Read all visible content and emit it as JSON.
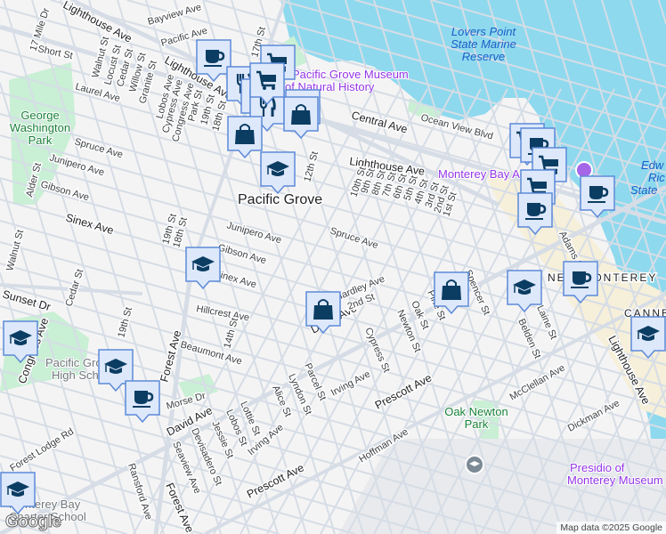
{
  "map": {
    "colors": {
      "land": "#f5f4f4",
      "water": "#8ed9ee",
      "park": "#c9efd5",
      "road": "#d6dde6",
      "marker_fill": "#dde8fb",
      "marker_border": "#5c8ad8",
      "marker_icon": "#0b3d63",
      "commercial": "#f6efd9",
      "military": "#e8eaed"
    },
    "labels": {
      "mile17": "17 Mile Dr",
      "lighthouse1": "Lighthouse Ave",
      "bayview": "Bayview Ave",
      "pacific": "Pacific Ave",
      "short": "Short St",
      "walnut": "Walnut St",
      "locust": "Locust St",
      "cedar": "Cedar St",
      "willow": "Willow St",
      "granite": "Granite St",
      "laurel": "Laurel Ave",
      "lighthouse2": "Lighthouse Ave",
      "lobos": "Lobos Ave",
      "cypressave": "Cypress Ave",
      "congress": "Congress Ave",
      "park": "Park St",
      "st19": "19th St",
      "st18": "18th St",
      "st17": "17th St",
      "spruce1": "Spruce Ave",
      "junipero1": "Junipero Ave",
      "gibson1": "Gibson Ave",
      "alder": "Alder St",
      "sinex1": "Sinex Ave",
      "walnut2": "Walnut St",
      "st19b": "19th St",
      "st18b": "18th St",
      "st12": "12th St",
      "junipero2": "Junipero Ave",
      "gibson2": "Gibson Ave",
      "sinex2": "Sinex Ave",
      "spruce2": "Spruce Ave",
      "central": "Central Ave",
      "oceanview": "Ocean View Blvd",
      "lighthouse3": "Lighthouse Ave",
      "st10": "10th St",
      "st9": "9th St",
      "st8": "8th St",
      "st7": "7th St",
      "st6": "6th St",
      "st5": "5th St",
      "st4": "4th St",
      "st3": "3rd St",
      "st2": "2nd St",
      "st1": "1st St",
      "hillcrest": "Hillcrest Ave",
      "beaumont": "Beaumont Ave",
      "morse": "Morse Dr",
      "sunset": "Sunset Dr",
      "cedar2": "Cedar St",
      "st19c": "19th St",
      "congress2": "Congress Ave",
      "forest1": "Forest Ave",
      "forest2": "Forest Ave",
      "st14": "14th St",
      "david1": "David Ave",
      "david2": "David Ave",
      "forestlodge": "Forest Lodge Rd",
      "seaview": "Seaview Ave",
      "ransford": "Ransford Ave",
      "devisadero": "Devisadero St",
      "jessie": "Jessie St",
      "lobosst": "Lobos St",
      "lottie": "Lottie St",
      "alice": "Alice St",
      "lyndon": "Lyndon St",
      "parcel": "Parcel St",
      "irving1": "Irving Ave",
      "prescott1": "Prescott Ave",
      "irving2": "Irving Ave",
      "prescott2": "Prescott Ave",
      "hoffman": "Hoffman Ave",
      "cypressst": "Cypress St",
      "newton": "Newton St",
      "oak": "Oak St",
      "pine": "Pine St",
      "spencer": "Spencer St",
      "belden": "Belden St",
      "laine": "Laine St",
      "mcclellan": "McClellan Ave",
      "dickman": "Dickman Ave",
      "lighthouse4": "Lighthouse Ave",
      "hardley": "Hardley Ave",
      "st2b": "2nd St",
      "adams": "Adams St"
    },
    "places": {
      "city": "Pacific Grove",
      "new_monterey": "NEW MONTEREY",
      "cannery": "CANNERY",
      "gw_park": [
        "George",
        "Washington",
        "Park"
      ],
      "oak_newton": [
        "Oak Newton",
        "Park"
      ],
      "museum": [
        "Pacific Grove Museum",
        "of Natural History"
      ],
      "aquarium": "Monterey Bay Aquarium",
      "lovers_point": [
        "Lovers Point",
        "State Marine",
        "Reserve"
      ],
      "ricketts": [
        "Edw",
        "Ric",
        "State"
      ],
      "high_school": [
        "Pacific Grove",
        "High School"
      ],
      "charter": [
        "Monterey Bay",
        "Charter School"
      ],
      "presidio": [
        "Presidio of",
        "Monterey Museum"
      ]
    },
    "markers": [
      {
        "type": "coffee"
      },
      {
        "type": "cart"
      },
      {
        "type": "restaurant"
      },
      {
        "type": "restaurant"
      },
      {
        "type": "restaurant"
      },
      {
        "type": "cart"
      },
      {
        "type": "shopping-bag"
      },
      {
        "type": "shopping-bag"
      },
      {
        "type": "shopping-bag"
      },
      {
        "type": "school"
      },
      {
        "type": "school"
      },
      {
        "type": "school"
      },
      {
        "type": "school"
      },
      {
        "type": "coffee"
      },
      {
        "type": "school"
      },
      {
        "type": "shopping-bag"
      },
      {
        "type": "shopping-bag"
      },
      {
        "type": "cart"
      },
      {
        "type": "coffee"
      },
      {
        "type": "cart"
      },
      {
        "type": "cart"
      },
      {
        "type": "coffee"
      },
      {
        "type": "coffee"
      },
      {
        "type": "school"
      },
      {
        "type": "coffee"
      },
      {
        "type": "school"
      }
    ],
    "attribution": "Map data ©2025 Google",
    "logo": "Google"
  }
}
